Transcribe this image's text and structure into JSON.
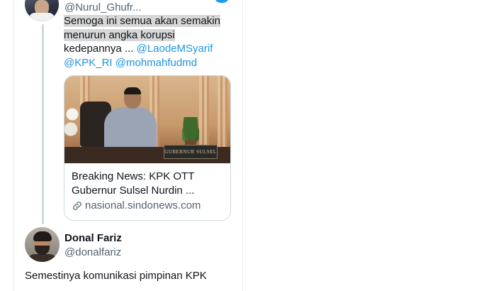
{
  "tweet1": {
    "handle": "@Nurul_Ghufr...",
    "text_highlight_line1": "Semoga ini semua akan semakin",
    "text_highlight_line2": "menurun angka korupsi",
    "text_line3": "kedepannya ...",
    "mention1": "@LaodeMSyarif",
    "mention2": "@KPK_RI",
    "mention3": "@mohmahfudmd",
    "card": {
      "title": "Breaking News: KPK OTT Gubernur Sulsel Nurdin ...",
      "domain": "nasional.sindonews.com",
      "nameplate": "GUBERNUR SULSEL",
      "icon": "link-icon"
    }
  },
  "tweet2": {
    "name": "Donal Fariz",
    "handle": "@donalfariz",
    "text": "Semestinya komunikasi pimpinan KPK"
  },
  "colors": {
    "mention": "#1b95e0",
    "secondary_text": "#536471",
    "highlight": "#d7d7d7",
    "border": "#e6ecf0"
  }
}
